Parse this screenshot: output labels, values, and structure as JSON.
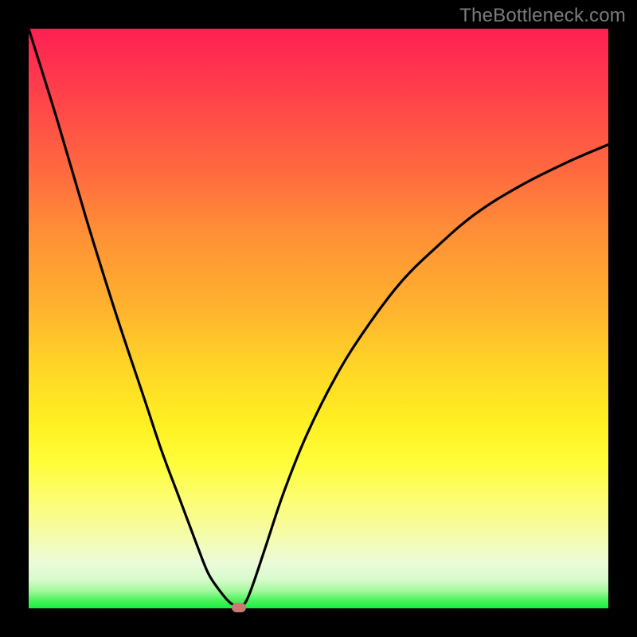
{
  "watermark": "TheBottleneck.com",
  "colors": {
    "curve_stroke": "#000000",
    "marker_fill": "#cb7971",
    "frame_bg": "#000000"
  },
  "chart_data": {
    "type": "line",
    "title": "",
    "xlabel": "",
    "ylabel": "",
    "xlim": [
      0,
      100
    ],
    "ylim": [
      0,
      100
    ],
    "grid": false,
    "series": [
      {
        "name": "bottleneck-curve",
        "x": [
          0,
          5,
          10,
          15,
          20,
          23,
          26,
          29,
          31,
          33,
          34.5,
          35.5,
          36.3,
          37,
          37.8,
          39,
          41,
          44,
          48,
          53,
          58,
          64,
          70,
          77,
          85,
          93,
          100
        ],
        "values": [
          100,
          84,
          67,
          51,
          36,
          27,
          19,
          11,
          6,
          3,
          1.2,
          0.5,
          0.2,
          0.5,
          1.8,
          5,
          11,
          20,
          30,
          40,
          48,
          56,
          62,
          68,
          73,
          77,
          80
        ]
      }
    ],
    "marker": {
      "x": 36.3,
      "y": 0.2
    },
    "gradient_stops": [
      {
        "pos": 0.0,
        "color": "#fe2052"
      },
      {
        "pos": 0.25,
        "color": "#ff6b3f"
      },
      {
        "pos": 0.5,
        "color": "#ffb22e"
      },
      {
        "pos": 0.7,
        "color": "#fff022"
      },
      {
        "pos": 0.9,
        "color": "#ecfbd9"
      },
      {
        "pos": 1.0,
        "color": "#17ef3f"
      }
    ]
  }
}
